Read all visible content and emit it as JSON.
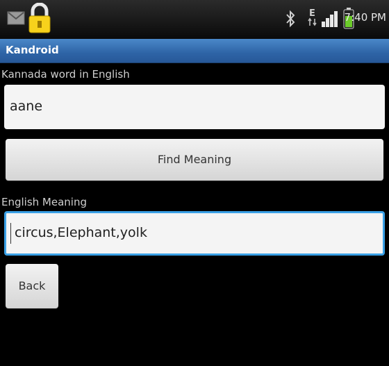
{
  "status_bar": {
    "time": "7:40 PM",
    "icons": [
      "mail-icon",
      "lock-icon",
      "bluetooth-icon",
      "edge-data-icon",
      "signal-icon",
      "battery-icon"
    ]
  },
  "app": {
    "title": "Kandroid"
  },
  "form": {
    "kannada_label": "Kannada word in English",
    "kannada_value": "aane",
    "find_button": "Find Meaning",
    "english_label": "English Meaning",
    "english_value": "circus,Elephant,yolk",
    "back_button": "Back"
  },
  "colors": {
    "title_bar": "#3a76b8",
    "focus_border": "#3aa0e6",
    "background": "#000000"
  }
}
